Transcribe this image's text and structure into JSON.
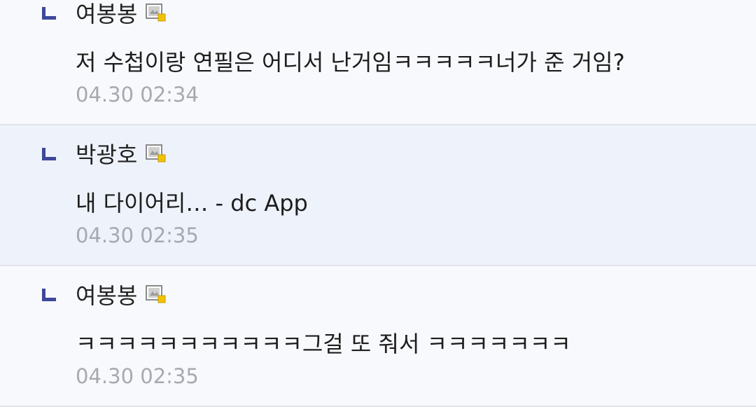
{
  "replies": [
    {
      "nickname": "여봉봉",
      "text": "저 수첩이랑 연필은 어디서 난거임ㅋㅋㅋㅋㅋ너가 준 거임?",
      "time": "04.30 02:34"
    },
    {
      "nickname": "박광호",
      "text": "내 다이어리… - dc App",
      "time": "04.30 02:35"
    },
    {
      "nickname": "여봉봉",
      "text": "ㅋㅋㅋㅋㅋㅋㅋㅋㅋㅋㅋ그걸 또 줘서 ㅋㅋㅋㅋㅋㅋㅋ",
      "time": "04.30 02:35"
    }
  ],
  "icons": {
    "reply": "reply-arrow-icon",
    "gallog": "gallog-icon"
  },
  "colors": {
    "reply_arrow": "#3d4899",
    "highlight_bg": "#eef2fb",
    "timestamp": "#a6a9b0"
  }
}
